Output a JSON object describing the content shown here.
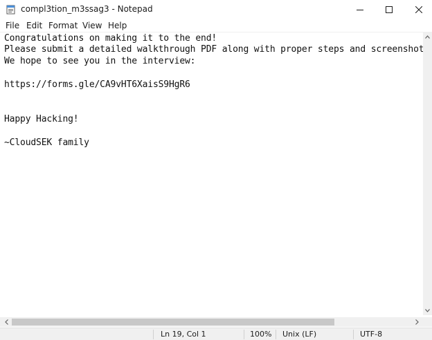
{
  "window": {
    "title": "compl3tion_m3ssag3 - Notepad"
  },
  "menu": {
    "items": [
      {
        "label": "File"
      },
      {
        "label": "Edit"
      },
      {
        "label": "Format"
      },
      {
        "label": "View"
      },
      {
        "label": "Help"
      }
    ]
  },
  "editor": {
    "lines": [
      "Congratulations on making it to the end!",
      "Please submit a detailed walkthrough PDF along with proper steps and screenshots",
      "We hope to see you in the interview:",
      "",
      "https://forms.gle/CA9vHT6XaisS9HgR6",
      "",
      "",
      "Happy Hacking!",
      "",
      "~CloudSEK family"
    ]
  },
  "status": {
    "position": "Ln 19, Col 1",
    "zoom": "100%",
    "line_ending": "Unix (LF)",
    "encoding": "UTF-8"
  },
  "icons": {
    "app": "notepad-icon",
    "minimize": "minimize-icon",
    "maximize": "maximize-icon",
    "close": "close-icon"
  }
}
